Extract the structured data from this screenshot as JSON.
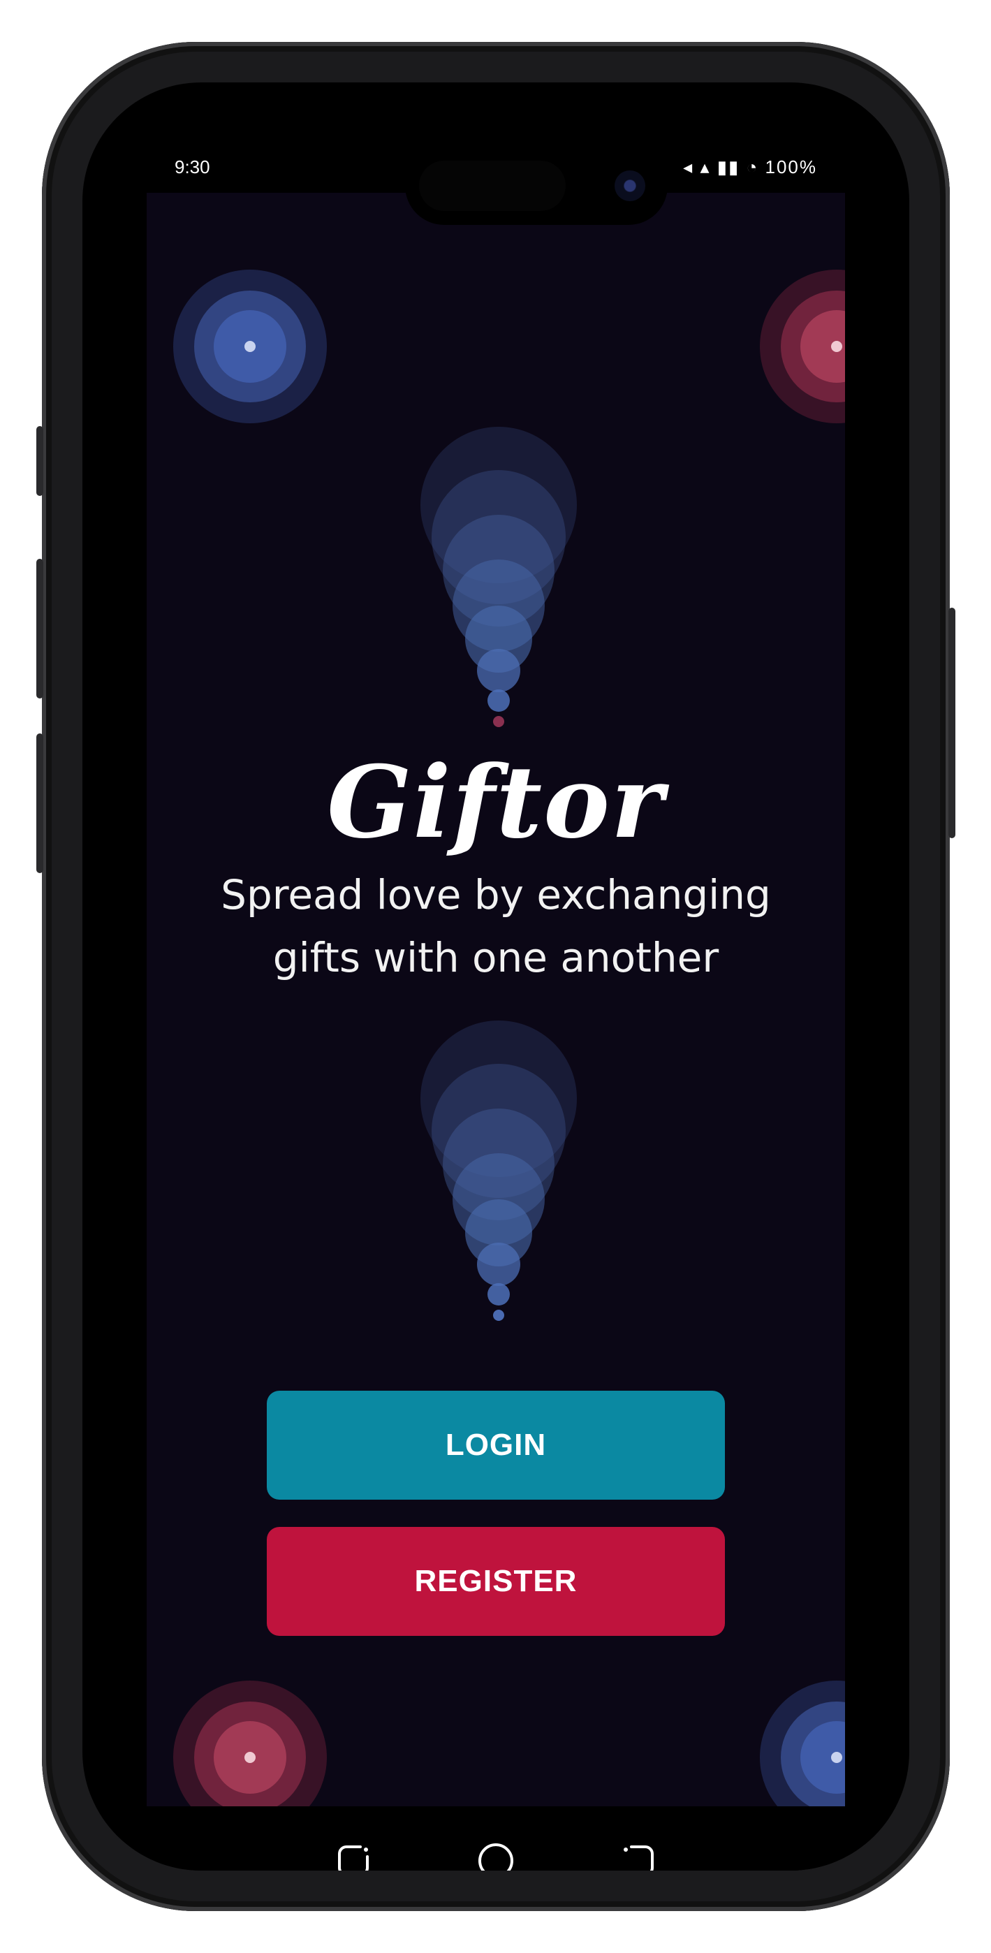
{
  "status_bar": {
    "time": "9:30",
    "icons": "◂ ▴ ▮▮ ◔ 100%"
  },
  "app": {
    "logo": "Giftor",
    "tagline_line1": "Spread love by exchanging",
    "tagline_line2": "gifts with one another"
  },
  "actions": {
    "login_label": "LOGIN",
    "register_label": "REGISTER"
  },
  "colors": {
    "background": "#0b0716",
    "login": "#0b89a2",
    "register": "#bf133d",
    "blue_target": "#3f5ba8",
    "red_target": "#a23a55"
  },
  "nav": {
    "back_icon": "back-icon",
    "home_icon": "home-icon",
    "recents_icon": "recents-icon"
  }
}
